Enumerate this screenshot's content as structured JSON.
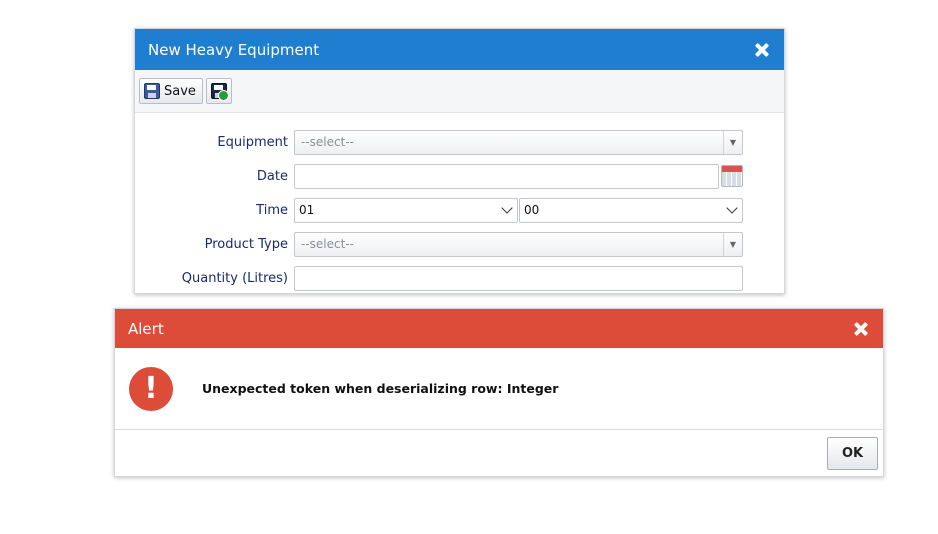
{
  "dialog": {
    "title": "New Heavy Equipment",
    "close_icon": "close-icon"
  },
  "toolbar": {
    "save_label": "Save",
    "save_icon": "floppy-disk-icon",
    "save_close_icon": "floppy-disk-check-icon"
  },
  "form": {
    "equipment": {
      "label": "Equipment",
      "value": "--select--"
    },
    "date": {
      "label": "Date",
      "value": "",
      "icon": "calendar-icon"
    },
    "time": {
      "label": "Time",
      "hour": "01",
      "minute": "00"
    },
    "product_type": {
      "label": "Product Type",
      "value": "--select--"
    },
    "quantity": {
      "label": "Quantity (Litres)",
      "value": ""
    }
  },
  "alert": {
    "title": "Alert",
    "icon": "error-exclamation-icon",
    "message": "Unexpected token when deserializing row: Integer",
    "ok_label": "OK",
    "colors": {
      "header": "#dd4b39"
    }
  },
  "colors": {
    "dialog_header": "#1f7ecf",
    "label_text": "#1a2a6c"
  }
}
